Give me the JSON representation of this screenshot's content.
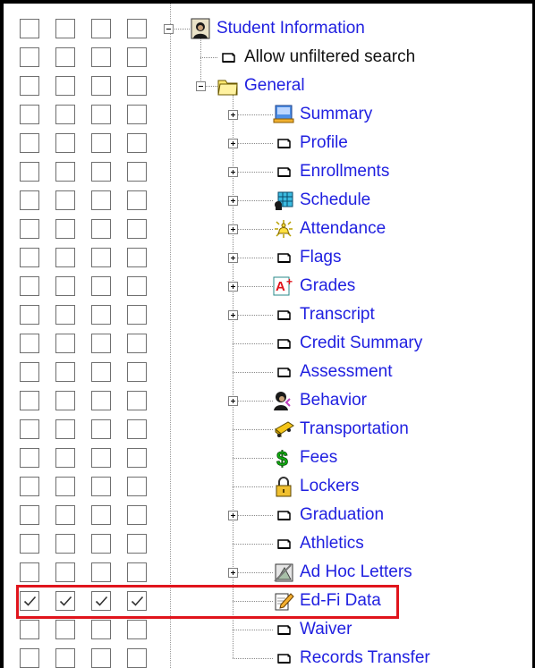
{
  "tree": {
    "items": [
      {
        "label": "Student Information",
        "depth": 0,
        "expander": "minus",
        "icon": "student-photo-icon",
        "color": "#1f1fe0",
        "checked": false
      },
      {
        "label": "Allow unfiltered search",
        "depth": 1,
        "expander": "none",
        "icon": "page-icon",
        "color": "#111111",
        "checked": false
      },
      {
        "label": "General",
        "depth": 1,
        "expander": "minus",
        "icon": "folder-icon",
        "color": "#1f1fe0",
        "checked": false
      },
      {
        "label": "Summary",
        "depth": 2,
        "expander": "plus",
        "icon": "summary-icon",
        "color": "#1f1fe0",
        "checked": false
      },
      {
        "label": "Profile",
        "depth": 2,
        "expander": "plus",
        "icon": "page-icon",
        "color": "#1f1fe0",
        "checked": false
      },
      {
        "label": "Enrollments",
        "depth": 2,
        "expander": "plus",
        "icon": "page-icon",
        "color": "#1f1fe0",
        "checked": false
      },
      {
        "label": "Schedule",
        "depth": 2,
        "expander": "plus",
        "icon": "schedule-icon",
        "color": "#1f1fe0",
        "checked": false
      },
      {
        "label": "Attendance",
        "depth": 2,
        "expander": "plus",
        "icon": "attendance-icon",
        "color": "#1f1fe0",
        "checked": false
      },
      {
        "label": "Flags",
        "depth": 2,
        "expander": "plus",
        "icon": "page-icon",
        "color": "#1f1fe0",
        "checked": false
      },
      {
        "label": "Grades",
        "depth": 2,
        "expander": "plus",
        "icon": "grades-icon",
        "color": "#1f1fe0",
        "checked": false
      },
      {
        "label": "Transcript",
        "depth": 2,
        "expander": "plus",
        "icon": "page-icon",
        "color": "#1f1fe0",
        "checked": false
      },
      {
        "label": "Credit Summary",
        "depth": 2,
        "expander": "none",
        "icon": "page-icon",
        "color": "#1f1fe0",
        "checked": false
      },
      {
        "label": "Assessment",
        "depth": 2,
        "expander": "none",
        "icon": "page-icon",
        "color": "#1f1fe0",
        "checked": false
      },
      {
        "label": "Behavior",
        "depth": 2,
        "expander": "plus",
        "icon": "behavior-icon",
        "color": "#1f1fe0",
        "checked": false
      },
      {
        "label": "Transportation",
        "depth": 2,
        "expander": "none",
        "icon": "bus-icon",
        "color": "#1f1fe0",
        "checked": false
      },
      {
        "label": "Fees",
        "depth": 2,
        "expander": "none",
        "icon": "dollar-icon",
        "color": "#1f1fe0",
        "checked": false
      },
      {
        "label": "Lockers",
        "depth": 2,
        "expander": "none",
        "icon": "lock-icon",
        "color": "#1f1fe0",
        "checked": false
      },
      {
        "label": "Graduation",
        "depth": 2,
        "expander": "plus",
        "icon": "page-icon",
        "color": "#1f1fe0",
        "checked": false
      },
      {
        "label": "Athletics",
        "depth": 2,
        "expander": "none",
        "icon": "page-icon",
        "color": "#1f1fe0",
        "checked": false
      },
      {
        "label": "Ad Hoc Letters",
        "depth": 2,
        "expander": "plus",
        "icon": "ad-hoc-letters-icon",
        "color": "#1f1fe0",
        "checked": false
      },
      {
        "label": "Ed-Fi Data",
        "depth": 2,
        "expander": "none",
        "icon": "edfi-icon",
        "color": "#1f1fe0",
        "checked": true,
        "highlighted": true
      },
      {
        "label": "Waiver",
        "depth": 2,
        "expander": "none",
        "icon": "page-icon",
        "color": "#1f1fe0",
        "checked": false
      },
      {
        "label": "Records Transfer",
        "depth": 2,
        "expander": "none",
        "icon": "page-icon",
        "color": "#1f1fe0",
        "checked": false
      }
    ]
  },
  "permission_columns": 4,
  "colors": {
    "highlight": "#e0141c",
    "link": "#1f1fe0"
  }
}
